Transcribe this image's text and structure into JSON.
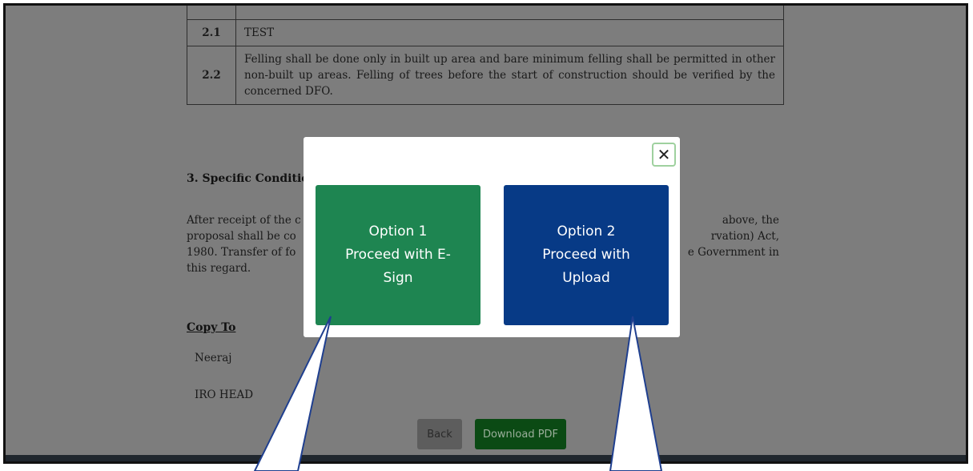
{
  "document": {
    "rows": [
      {
        "num": "2.1",
        "text": "TEST"
      },
      {
        "num": "2.2",
        "text": "Felling shall be done only in built up area and bare minimum felling shall be permitted in other non-built up areas. Felling of trees before the start of construction should be verified by the concerned DFO."
      }
    ],
    "section_title": "3. Specific Condition",
    "paragraph": {
      "line1_start": "After receipt of the c",
      "line1_end": "above, the",
      "line2_start": "proposal shall be co",
      "line2_end": "rvation) Act,",
      "line3_start": "1980. Transfer of fo",
      "line3_end": "e Government in",
      "line4": "this regard."
    },
    "copy_to_label": "Copy To",
    "copy_to": [
      "Neeraj",
      "IRO HEAD"
    ],
    "buttons": {
      "back": "Back",
      "download": "Download PDF"
    }
  },
  "modal": {
    "close_symbol": "✕",
    "option1": {
      "line1": "Option 1",
      "line2": "Proceed with E-",
      "line3": "Sign"
    },
    "option2": {
      "line1": "Option 2",
      "line2": "Proceed with",
      "line3": "Upload"
    }
  },
  "colors": {
    "option1_bg": "#1e8551",
    "option2_bg": "#073a86",
    "overlay": "#7d7d7d",
    "callout_stroke": "#1f3f8f"
  }
}
